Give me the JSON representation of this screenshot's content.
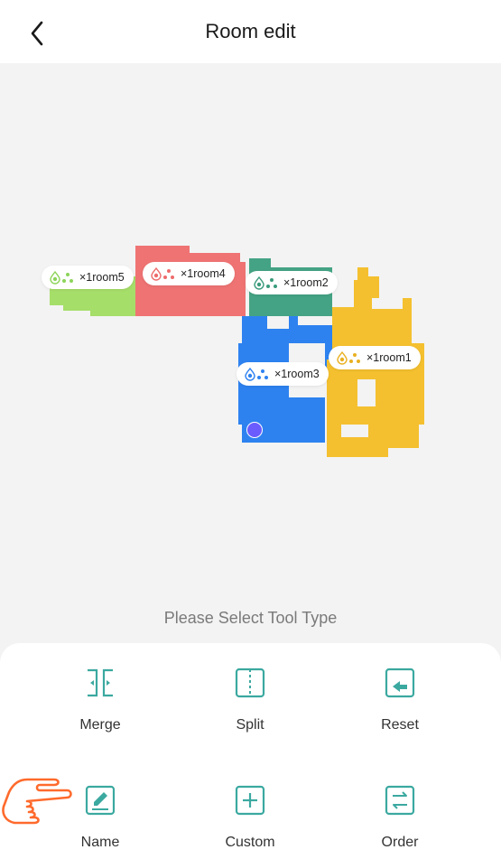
{
  "header": {
    "title": "Room edit",
    "back_icon": "chevron-left-icon"
  },
  "map": {
    "rooms": [
      {
        "name": "room5",
        "label": "×1room5",
        "color": "#a6de6a"
      },
      {
        "name": "room4",
        "label": "×1room4",
        "color": "#ef7373"
      },
      {
        "name": "room2",
        "label": "×1room2",
        "color": "#44a384"
      },
      {
        "name": "room3",
        "label": "×1room3",
        "color": "#2d82f0"
      },
      {
        "name": "room1",
        "label": "×1room1",
        "color": "#f4c02f"
      }
    ],
    "label_icons": [
      "water-drop-icon",
      "fan-icon"
    ],
    "dock_color": "#6a5cff"
  },
  "prompt": "Please Select Tool Type",
  "tools": [
    {
      "label": "Merge",
      "icon": "merge-icon"
    },
    {
      "label": "Split",
      "icon": "split-icon"
    },
    {
      "label": "Reset",
      "icon": "reset-icon"
    },
    {
      "label": "Name",
      "icon": "edit-name-icon"
    },
    {
      "label": "Custom",
      "icon": "custom-add-icon"
    },
    {
      "label": "Order",
      "icon": "order-swap-icon"
    }
  ],
  "accent_color": "#3ba9a0",
  "pointer_hand_color": "#ff6a2c"
}
